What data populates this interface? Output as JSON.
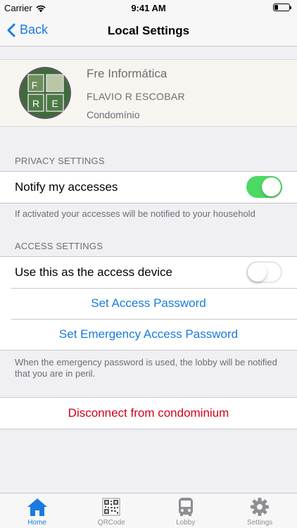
{
  "status_bar": {
    "carrier": "Carrier",
    "time": "9:41 AM"
  },
  "nav": {
    "back_label": "Back",
    "title": "Local Settings"
  },
  "profile": {
    "company": "Fre Informática",
    "user": "FLAVIO R ESCOBAR",
    "type": "Condomínio",
    "logo_letters": [
      "F",
      "R",
      "E"
    ]
  },
  "privacy": {
    "header": "PRIVACY SETTINGS",
    "notify_label": "Notify my accesses",
    "notify_on": true,
    "footer": "If activated your accesses will be notified to your household"
  },
  "access": {
    "header": "ACCESS SETTINGS",
    "device_label": "Use this as the access device",
    "device_on": false,
    "set_password": "Set Access Password",
    "set_emergency_password": "Set Emergency Access Password",
    "footer": "When the emergency password is used, the lobby will be notified that you are in peril."
  },
  "disconnect_label": "Disconnect from condominium",
  "tabs": [
    {
      "label": "Home",
      "icon": "home-icon",
      "active": true
    },
    {
      "label": "QRCode",
      "icon": "qrcode-icon",
      "active": false
    },
    {
      "label": "Lobby",
      "icon": "bus-icon",
      "active": false
    },
    {
      "label": "Settings",
      "icon": "gear-icon",
      "active": false
    }
  ],
  "colors": {
    "accent": "#1a7ae0",
    "toggle_on": "#4cd964",
    "danger": "#d0021b",
    "background": "#efeff4"
  }
}
